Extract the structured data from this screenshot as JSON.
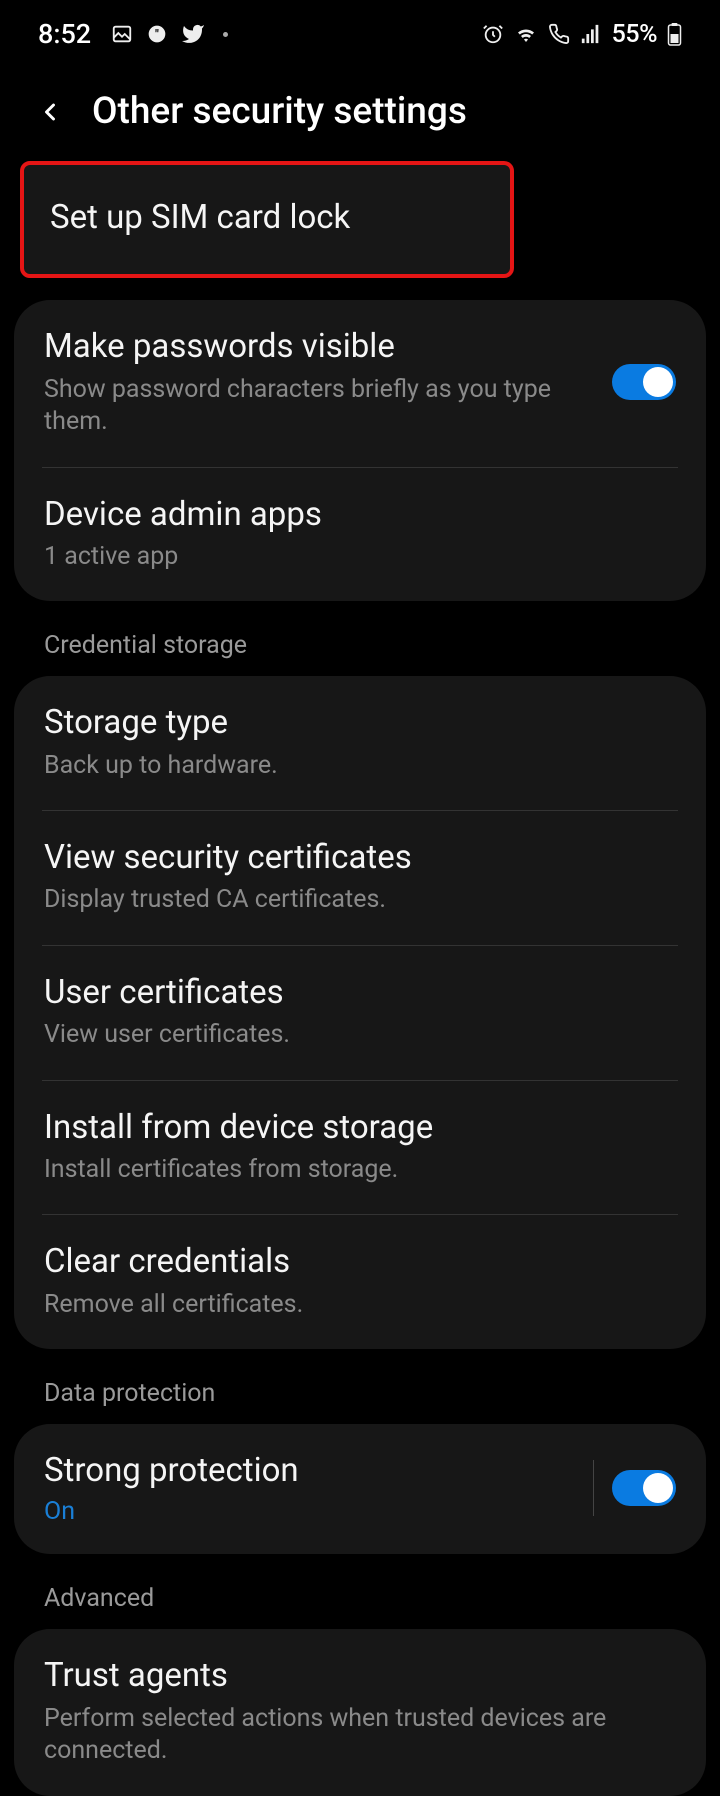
{
  "statusBar": {
    "time": "8:52",
    "battery": "55%"
  },
  "header": {
    "title": "Other security settings"
  },
  "highlightItem": {
    "title": "Set up SIM card lock"
  },
  "group1": {
    "item0": {
      "title": "Make passwords visible",
      "subtitle": "Show password characters briefly as you type them."
    },
    "item1": {
      "title": "Device admin apps",
      "subtitle": "1 active app"
    }
  },
  "section1": {
    "header": "Credential storage"
  },
  "group2": {
    "item0": {
      "title": "Storage type",
      "subtitle": "Back up to hardware."
    },
    "item1": {
      "title": "View security certificates",
      "subtitle": "Display trusted CA certificates."
    },
    "item2": {
      "title": "User certificates",
      "subtitle": "View user certificates."
    },
    "item3": {
      "title": "Install from device storage",
      "subtitle": "Install certificates from storage."
    },
    "item4": {
      "title": "Clear credentials",
      "subtitle": "Remove all certificates."
    }
  },
  "section2": {
    "header": "Data protection"
  },
  "group3": {
    "item0": {
      "title": "Strong protection",
      "subtitle": "On"
    }
  },
  "section3": {
    "header": "Advanced"
  },
  "group4": {
    "item0": {
      "title": "Trust agents",
      "subtitle": "Perform selected actions when trusted devices are connected."
    }
  }
}
